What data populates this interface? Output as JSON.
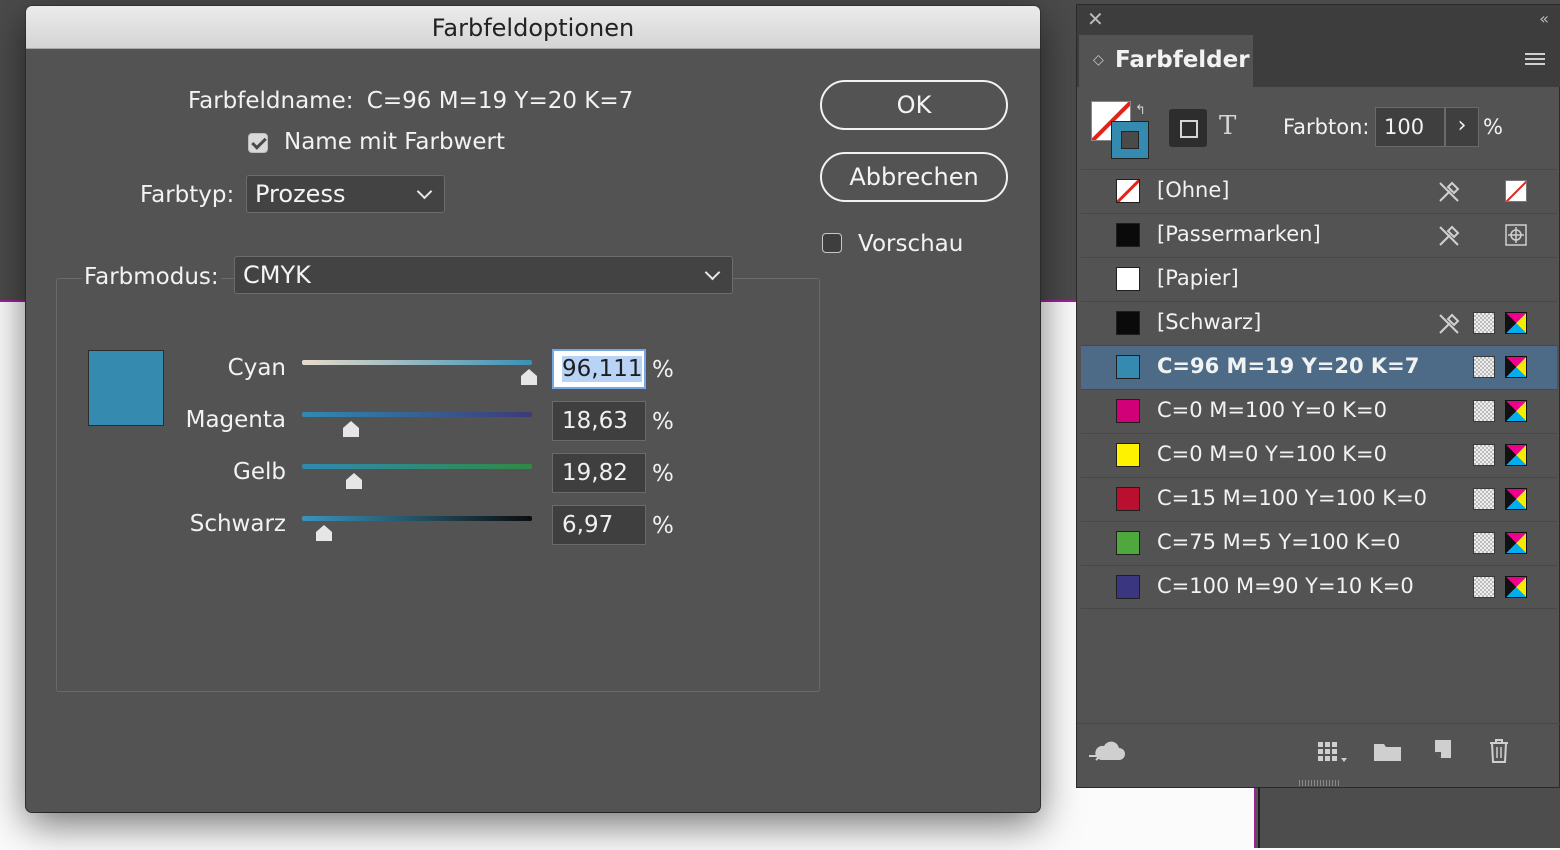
{
  "dialog": {
    "title": "Farbfeldoptionen",
    "swatch_name_label": "Farbfeldname:",
    "swatch_name_value": "C=96 M=19 Y=20 K=7",
    "name_with_value_label": "Name mit Farbwert",
    "name_with_value_checked": true,
    "color_type_label": "Farbtyp:",
    "color_type_value": "Prozess",
    "color_mode_label": "Farbmodus:",
    "color_mode_value": "CMYK",
    "ok_label": "OK",
    "cancel_label": "Abbrechen",
    "preview_label": "Vorschau",
    "preview_checked": false,
    "preview_color": "#358ab0",
    "percent_sign": "%",
    "sliders": [
      {
        "label": "Cyan",
        "value": "96,111",
        "fraction": 0.96111
      },
      {
        "label": "Magenta",
        "value": "18,63",
        "fraction": 0.1863
      },
      {
        "label": "Gelb",
        "value": "19,82",
        "fraction": 0.1982
      },
      {
        "label": "Schwarz",
        "value": "6,97",
        "fraction": 0.0697
      }
    ]
  },
  "panel": {
    "tab_label": "Farbfelder",
    "tint_label": "Farbton:",
    "tint_value": "100",
    "tint_unit": "%",
    "swatches": [
      {
        "name": "[Ohne]",
        "color": "none"
      },
      {
        "name": "[Passermarken]",
        "color": "#0a0a0a"
      },
      {
        "name": "[Papier]",
        "color": "#ffffff"
      },
      {
        "name": "[Schwarz]",
        "color": "#0a0a0a"
      },
      {
        "name": "C=96 M=19 Y=20 K=7",
        "color": "#358ab0"
      },
      {
        "name": "C=0 M=100 Y=0 K=0",
        "color": "#d10079"
      },
      {
        "name": "C=0 M=0 Y=100 K=0",
        "color": "#fff200"
      },
      {
        "name": "C=15 M=100 Y=100 K=0",
        "color": "#b8102e"
      },
      {
        "name": "C=75 M=5 Y=100 K=0",
        "color": "#4fa83d"
      },
      {
        "name": "C=100 M=90 Y=10 K=0",
        "color": "#3a3680"
      }
    ]
  }
}
